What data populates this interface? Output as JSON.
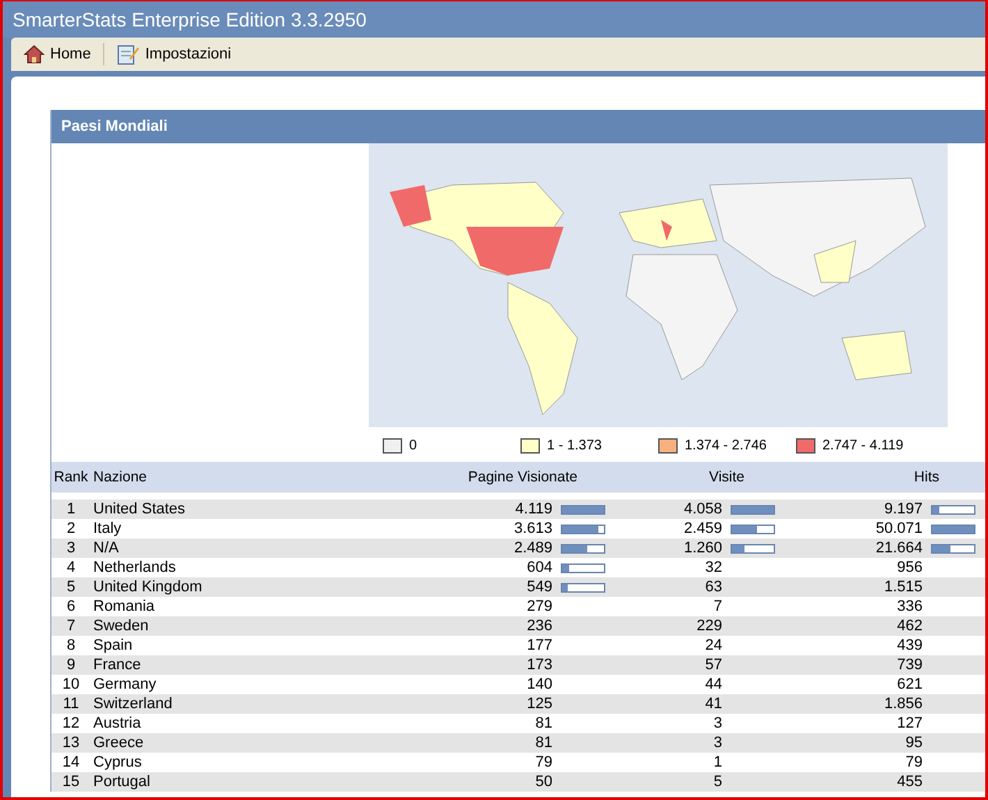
{
  "window": {
    "title": "SmarterStats Enterprise Edition 3.3.2950"
  },
  "toolbar": [
    {
      "label": "Home",
      "kind": "home"
    },
    {
      "label": "Impostazioni",
      "kind": "settings"
    }
  ],
  "panel": {
    "title": "Paesi Mondiali",
    "legend": [
      {
        "label": "0",
        "color": "#f0f0f0"
      },
      {
        "label": "1 - 1.373",
        "color": "#ffffc8"
      },
      {
        "label": "1.374 - 2.746",
        "color": "#f8b080"
      },
      {
        "label": "2.747 - 4.119",
        "color": "#f06a6a"
      }
    ],
    "table": {
      "columns": [
        "Rank",
        "Nazione",
        "Pagine Visionate",
        "Visite",
        "Hits"
      ],
      "rows": [
        {
          "rank": "1",
          "country": "United States",
          "pages": {
            "text": "4.119",
            "level": 1
          },
          "visits": {
            "text": "4.058",
            "level": 1
          },
          "hits": {
            "text": "9.197",
            "level": 0.18
          }
        },
        {
          "rank": "2",
          "country": "Italy",
          "pages": {
            "text": "3.613",
            "level": 0.88
          },
          "visits": {
            "text": "2.459",
            "level": 0.6
          },
          "hits": {
            "text": "50.071",
            "level": 1
          }
        },
        {
          "rank": "3",
          "country": "N/A",
          "pages": {
            "text": "2.489",
            "level": 0.6
          },
          "visits": {
            "text": "1.260",
            "level": 0.31
          },
          "hits": {
            "text": "21.664",
            "level": 0.43
          }
        },
        {
          "rank": "4",
          "country": "Netherlands",
          "pages": {
            "text": "604",
            "level": 0.15
          },
          "visits": {
            "text": "32"
          },
          "hits": {
            "text": "956"
          }
        },
        {
          "rank": "5",
          "country": "United Kingdom",
          "pages": {
            "text": "549",
            "level": 0.13
          },
          "visits": {
            "text": "63"
          },
          "hits": {
            "text": "1.515"
          }
        },
        {
          "rank": "6",
          "country": "Romania",
          "pages": {
            "text": "279"
          },
          "visits": {
            "text": "7"
          },
          "hits": {
            "text": "336"
          }
        },
        {
          "rank": "7",
          "country": "Sweden",
          "pages": {
            "text": "236"
          },
          "visits": {
            "text": "229"
          },
          "hits": {
            "text": "462"
          }
        },
        {
          "rank": "8",
          "country": "Spain",
          "pages": {
            "text": "177"
          },
          "visits": {
            "text": "24"
          },
          "hits": {
            "text": "439"
          }
        },
        {
          "rank": "9",
          "country": "France",
          "pages": {
            "text": "173"
          },
          "visits": {
            "text": "57"
          },
          "hits": {
            "text": "739"
          }
        },
        {
          "rank": "10",
          "country": "Germany",
          "pages": {
            "text": "140"
          },
          "visits": {
            "text": "44"
          },
          "hits": {
            "text": "621"
          }
        },
        {
          "rank": "11",
          "country": "Switzerland",
          "pages": {
            "text": "125"
          },
          "visits": {
            "text": "41"
          },
          "hits": {
            "text": "1.856"
          }
        },
        {
          "rank": "12",
          "country": "Austria",
          "pages": {
            "text": "81"
          },
          "visits": {
            "text": "3"
          },
          "hits": {
            "text": "127"
          }
        },
        {
          "rank": "13",
          "country": "Greece",
          "pages": {
            "text": "81"
          },
          "visits": {
            "text": "3"
          },
          "hits": {
            "text": "95"
          }
        },
        {
          "rank": "14",
          "country": "Cyprus",
          "pages": {
            "text": "79"
          },
          "visits": {
            "text": "1"
          },
          "hits": {
            "text": "79"
          }
        },
        {
          "rank": "15",
          "country": "Portugal",
          "pages": {
            "text": "50"
          },
          "visits": {
            "text": "5"
          },
          "hits": {
            "text": "455"
          }
        }
      ]
    }
  }
}
